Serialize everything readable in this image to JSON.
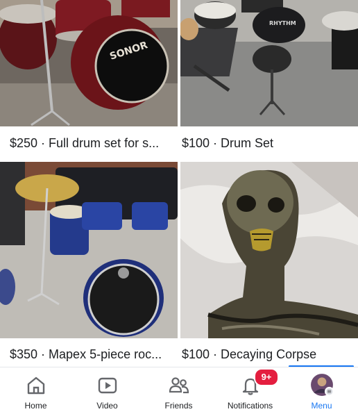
{
  "listings": [
    {
      "price_title": "$250 · Full drum set for s...",
      "drum_brand": "SONOR"
    },
    {
      "price_title": "$100 · Drum Set",
      "drum_brand": "RHYTHM"
    },
    {
      "price_title": "$350 · Mapex 5-piece roc..."
    },
    {
      "price_title": "$100 · Decaying Corpse"
    }
  ],
  "tabs": [
    {
      "label": "Home",
      "icon": "home-icon"
    },
    {
      "label": "Video",
      "icon": "video-icon"
    },
    {
      "label": "Friends",
      "icon": "friends-icon"
    },
    {
      "label": "Notifications",
      "icon": "bell-icon",
      "badge": "9+"
    },
    {
      "label": "Menu",
      "icon": "avatar",
      "active": true
    }
  ],
  "colors": {
    "accent": "#1877f2",
    "badge": "#e41e3f"
  }
}
